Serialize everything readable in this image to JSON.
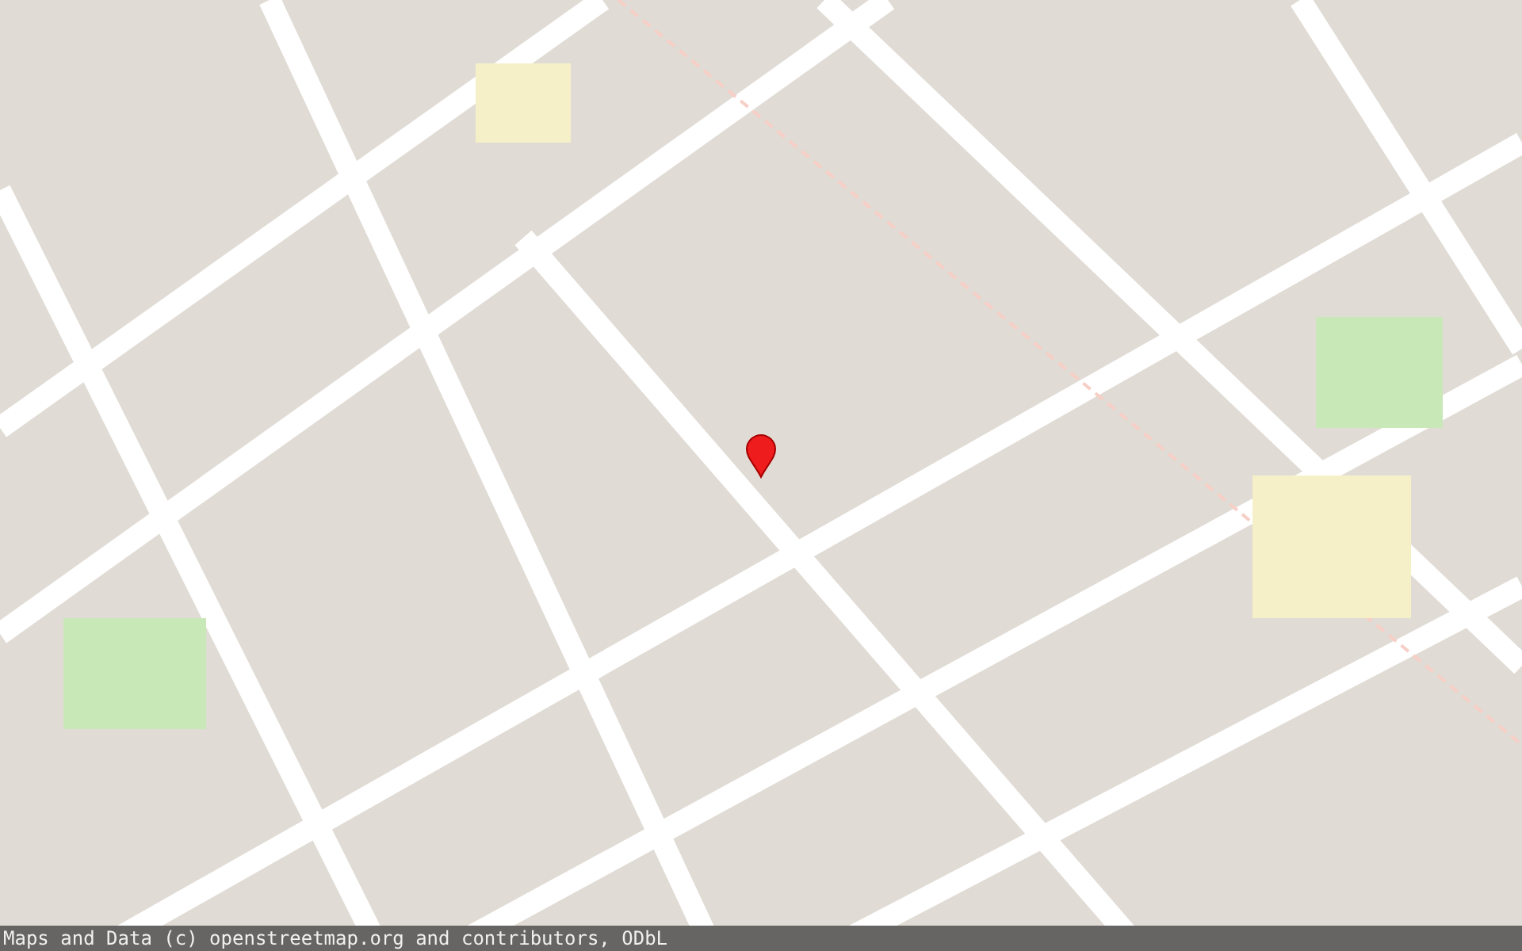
{
  "map": {
    "marker": {
      "kind": "pin"
    }
  },
  "attribution": "Maps and Data (c) openstreetmap.org and contributors, ODbL"
}
